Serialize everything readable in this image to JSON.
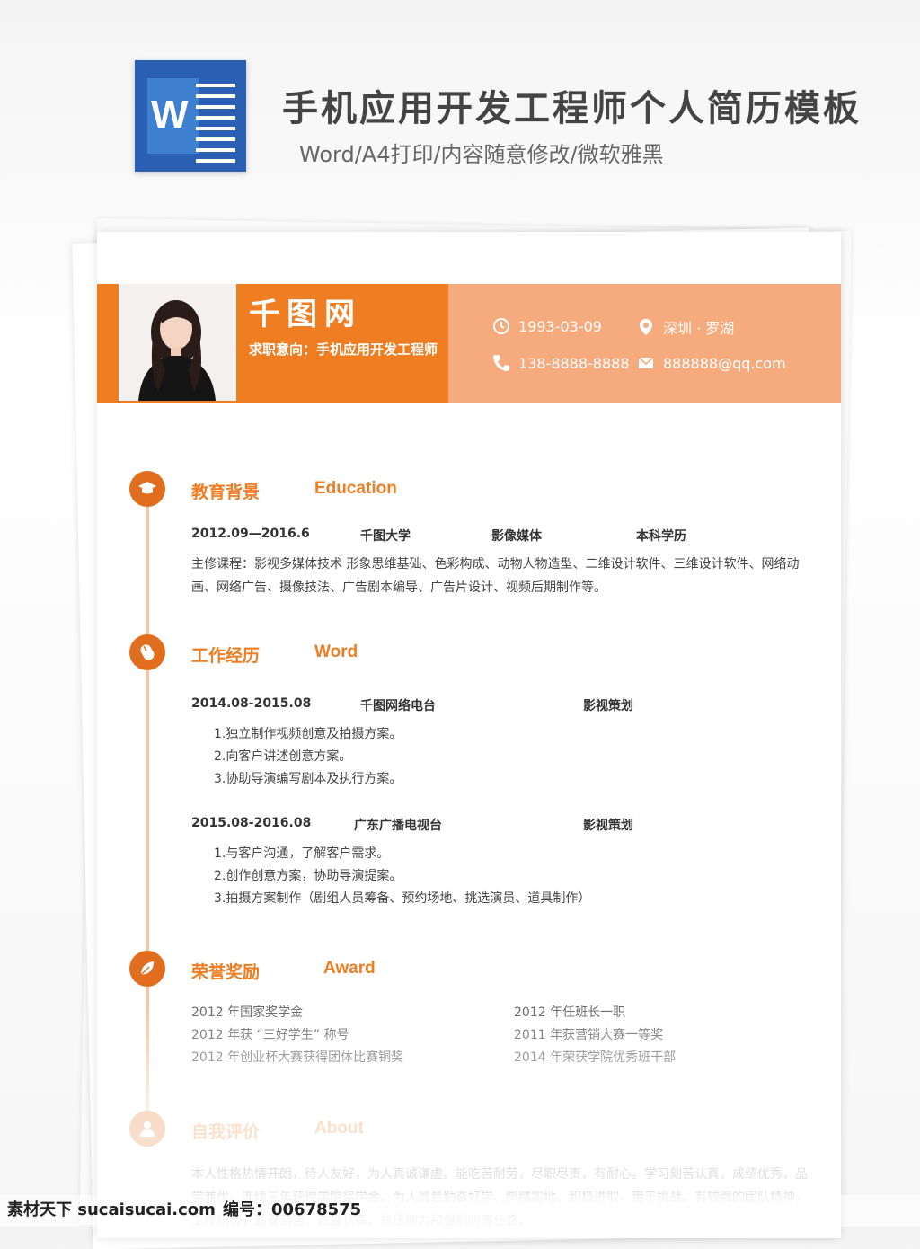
{
  "banner": {
    "title": "手机应用开发工程师个人简历模板",
    "subtitle": "Word/A4打印/内容随意修改/微软雅黑"
  },
  "resume": {
    "name": "千图网",
    "intent": "求职意向：手机应用开发工程师",
    "birth": "1993-03-09",
    "location": "深圳 · 罗湖",
    "phone": "138-8888-8888",
    "email": "888888@qq.com",
    "education": {
      "title_cn": "教育背景",
      "title_en": "Education",
      "period": "2012.09—2016.6",
      "school": "千图大学",
      "major": "影像媒体",
      "degree": "本科学历",
      "courses": "主修课程：影视多媒体技术 形象思维基础、色彩构成、动物人物造型、二维设计软件、三维设计软件、网络动画、网络广告、摄像技法、广告剧本编导、广告片设计、视频后期制作等。"
    },
    "work": {
      "title_cn": "工作经历",
      "title_en": "Word",
      "jobs": [
        {
          "period": "2014.08-2015.08",
          "company": "千图网络电台",
          "role": "影视策划",
          "duties": [
            "1.独立制作视频创意及拍摄方案。",
            "2.向客户讲述创意方案。",
            "3.协助导演编写剧本及执行方案。"
          ]
        },
        {
          "period": "2015.08-2016.08",
          "company": "广东广播电视台",
          "role": "影视策划",
          "duties": [
            "1.与客户沟通，了解客户需求。",
            "2.创作创意方案，协助导演提案。",
            "3.拍摄方案制作（剧组人员筹备、预约场地、挑选演员、道具制作）"
          ]
        }
      ]
    },
    "award": {
      "title_cn": "荣誉奖励",
      "title_en": "Award",
      "left": [
        "2012 年国家奖学金",
        "2012 年获 “三好学生” 称号",
        "2012 年创业杯大赛获得团体比赛铜奖"
      ],
      "right": [
        "2012 年任班长一职",
        "2011 年获营销大赛一等奖",
        "2014 年荣获学院优秀班干部"
      ]
    },
    "about": {
      "title_cn": "自我评价",
      "title_en": "About",
      "text": "本人性格热情开朗，待人友好，为人真诚谦虚。能吃苦耐劳，尽职尽责，有耐心。学习刻苦认真，成绩优秀，品学兼优，连续三年获得学院奖学金。为人诚恳勤奋好学、脚踏实地，积极进取，用于挑战。有较强的团队精神，工作积极，勤奋刻苦，态度认真。抗压能力和强烈的责任感。"
    }
  },
  "watermark": {
    "site": "素材天下 sucaisucai.com",
    "number": "编号：00678575"
  },
  "colors": {
    "accent": "#ef7d22",
    "accent_light": "#f5ab7d",
    "word_blue": "#2b5fb4"
  }
}
